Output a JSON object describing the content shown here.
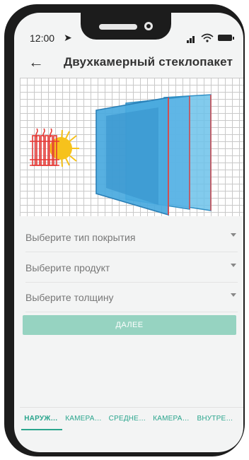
{
  "status_bar": {
    "time": "12:00",
    "nav_glyph": "➤"
  },
  "app_bar": {
    "back_glyph": "←",
    "title": "Двухкамерный стеклопакет"
  },
  "form": {
    "coating_placeholder": "Выберите тип покрытия",
    "product_placeholder": "Выберите продукт",
    "thickness_placeholder": "Выберите толщину",
    "next_label": "ДАЛЕЕ"
  },
  "tabs": [
    {
      "label": "НАРУЖ…",
      "active": true
    },
    {
      "label": "КАМЕРА…",
      "active": false
    },
    {
      "label": "СРЕДНЕ…",
      "active": false
    },
    {
      "label": "КАМЕРА…",
      "active": false
    },
    {
      "label": "ВНУТРЕ…",
      "active": false
    }
  ],
  "colors": {
    "accent": "#2aa58d",
    "button": "#96d3c1",
    "glass": "#4aa8dc",
    "radiator": "#e53935",
    "sun": "#f6c21c"
  },
  "icons": [
    "back-arrow-icon",
    "navigation-arrow-icon",
    "signal-icon",
    "wifi-icon",
    "battery-icon",
    "dropdown-caret-icon",
    "radiator-icon",
    "sun-icon"
  ]
}
